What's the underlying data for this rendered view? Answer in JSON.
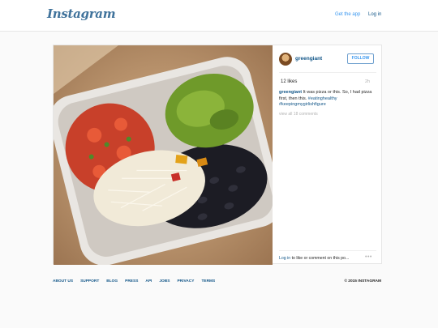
{
  "header": {
    "logo_text": "Instagram",
    "get_app": "Get the app",
    "login": "Log in"
  },
  "post": {
    "username": "greengiant",
    "follow_label": "FOLLOW",
    "likes": "12 likes",
    "age": "2h",
    "caption_user": "greengiant",
    "caption_text": " It was pizza or this. So, I had pizza first, then this. ",
    "hashtags": [
      "#eatinghealthy",
      "#keepingmygirlishfigure"
    ],
    "view_all": "view all 18 comments",
    "login_link": "Log in",
    "login_rest": " to like or comment on this po...",
    "more": "•••"
  },
  "footer": {
    "links": [
      "ABOUT US",
      "SUPPORT",
      "BLOG",
      "PRESS",
      "API",
      "JOBS",
      "PRIVACY",
      "TERMS"
    ],
    "copyright": "© 2015 INSTAGRAM"
  },
  "colors": {
    "brand_blue": "#3f729b",
    "link_blue": "#125688",
    "accent_blue": "#3897f0"
  }
}
